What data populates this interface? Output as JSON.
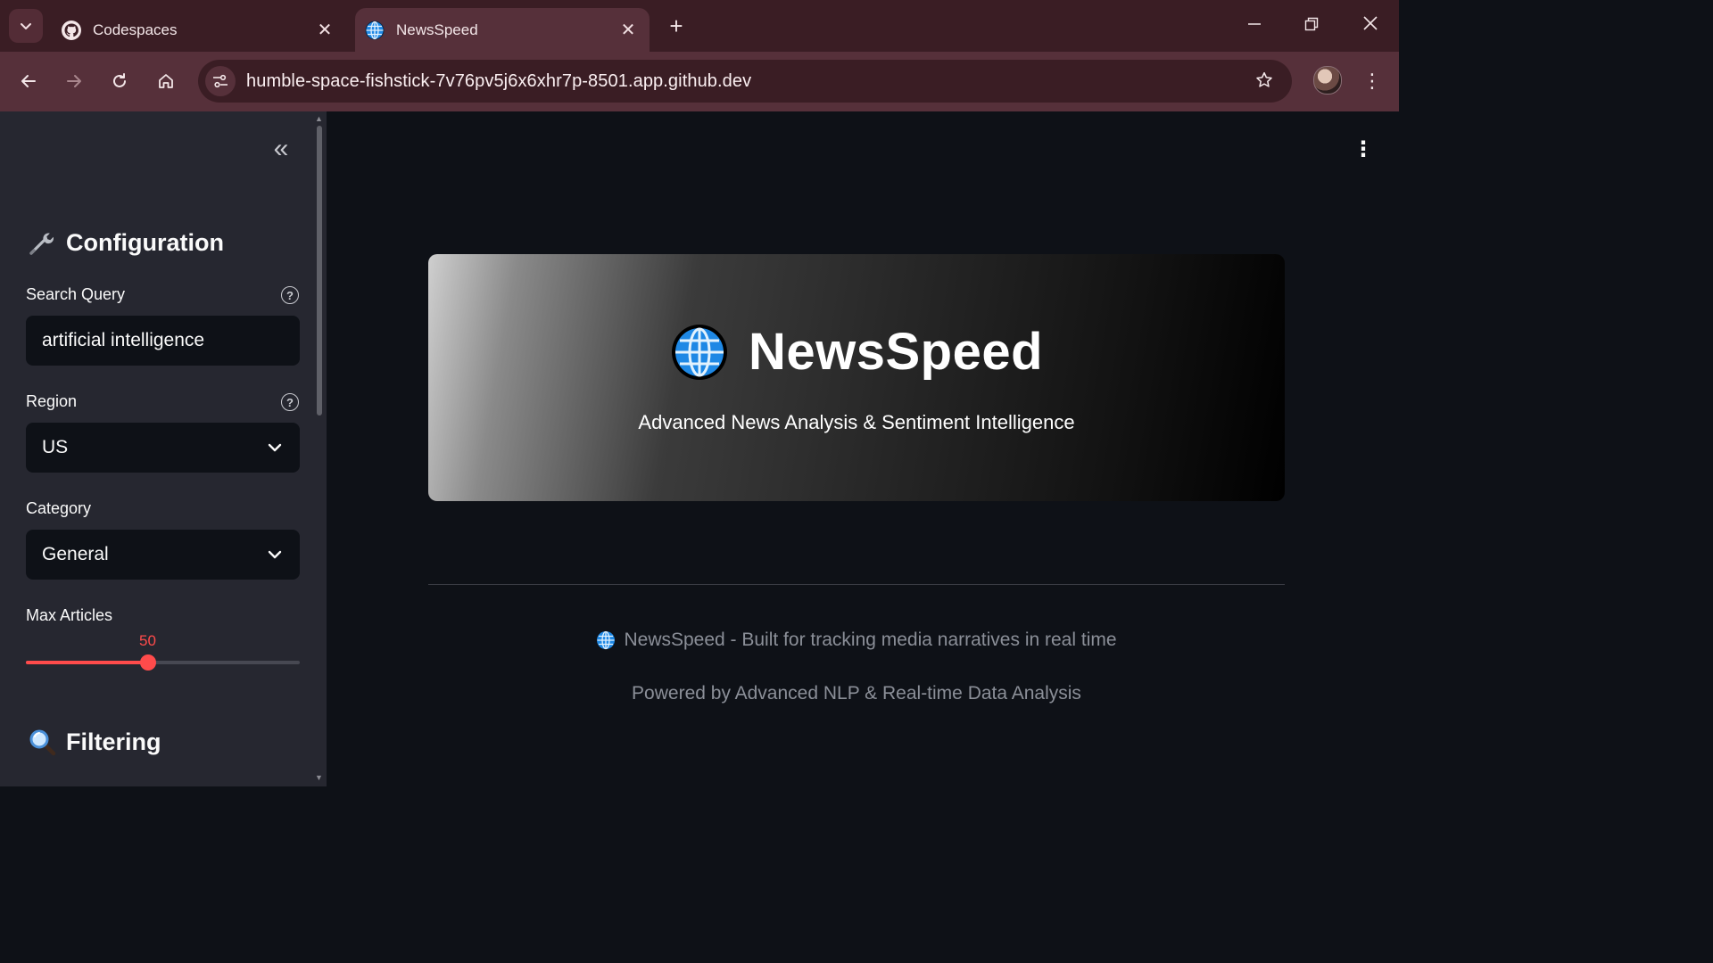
{
  "browser": {
    "tabs": [
      {
        "title": "Codespaces",
        "active": false,
        "icon": "github-icon"
      },
      {
        "title": "NewsSpeed",
        "active": true,
        "icon": "globe-icon"
      }
    ],
    "url": "humble-space-fishstick-7v76pv5j6x6xhr7p-8501.app.github.dev"
  },
  "sidebar": {
    "config_header": "Configuration",
    "config_icon": "wrench-icon",
    "search_query": {
      "label": "Search Query",
      "value": "artificial intelligence"
    },
    "region": {
      "label": "Region",
      "value": "US"
    },
    "category": {
      "label": "Category",
      "value": "General"
    },
    "max_articles": {
      "label": "Max Articles",
      "value": "50",
      "fraction": 0.445
    },
    "filter_header": "Filtering",
    "filter_icon": "magnifier-icon"
  },
  "main": {
    "hero": {
      "title": "NewsSpeed",
      "subtitle": "Advanced News Analysis & Sentiment Intelligence"
    },
    "footer": {
      "line1": "NewsSpeed - Built for tracking media narratives in real time",
      "line2": "Powered by Advanced NLP & Real-time Data Analysis"
    }
  },
  "colors": {
    "accent": "#ff4b4b",
    "sidebar_bg": "#262730",
    "main_bg": "#0e1117",
    "browser_frame": "#3a1d24"
  }
}
